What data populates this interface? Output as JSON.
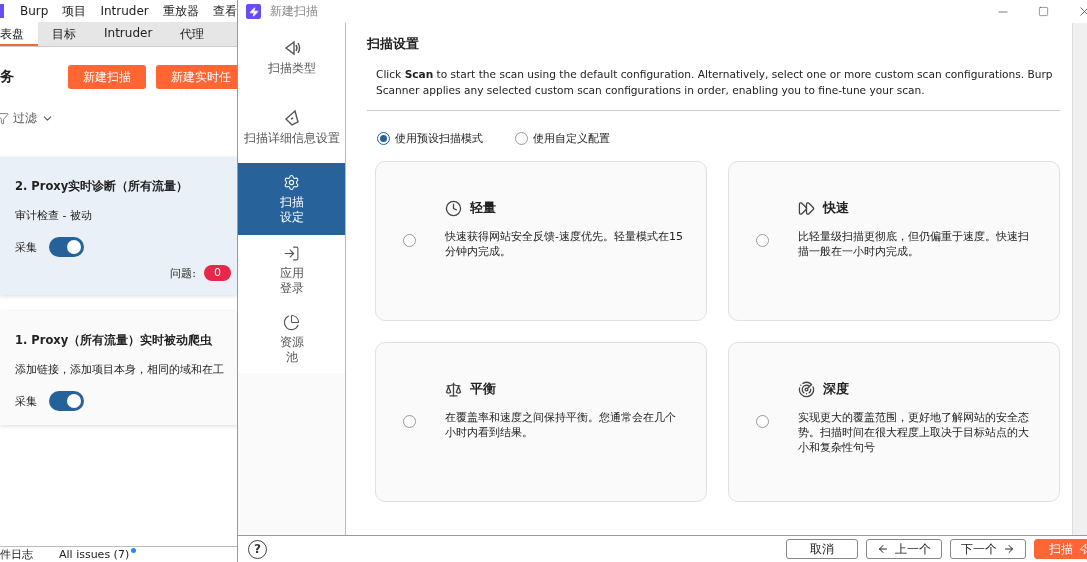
{
  "app": {
    "menu": [
      "Burp",
      "项目",
      "Intruder",
      "重放器",
      "查看"
    ],
    "tabs": [
      {
        "label": "表盘",
        "selected": true
      },
      {
        "label": "目标",
        "selected": false
      },
      {
        "label": "Intruder",
        "selected": false
      },
      {
        "label": "代理",
        "selected": false
      }
    ],
    "heading": "务",
    "buttons": [
      "新建扫描",
      "新建实时任"
    ],
    "filter": "过滤",
    "tasks": [
      {
        "title": "2. Proxy实时诊断（所有流量）",
        "subtitle": "审计检查 - 被动",
        "toggle_label": "采集",
        "on": true,
        "selected": true,
        "issues_label": "问题:",
        "issues": "0"
      },
      {
        "title": "1. Proxy（所有流量）实时被动爬虫",
        "subtitle": "添加链接，添加项目本身，相同的域和在工",
        "toggle_label": "采集",
        "on": true,
        "selected": false
      }
    ],
    "status_tabs": [
      {
        "label": "件日志",
        "dot": false
      },
      {
        "label": "All issues (7)",
        "dot": true
      }
    ]
  },
  "dialog": {
    "title": "新建扫描",
    "nav": [
      {
        "label": "扫描类型",
        "selected": false
      },
      {
        "label": "扫描详细信息设置",
        "selected": false
      },
      {
        "label": "扫描设定",
        "selected": true
      },
      {
        "label": "应用登录",
        "selected": false
      },
      {
        "label": "资源池",
        "selected": false
      }
    ],
    "heading": "扫描设置",
    "intro": "Click **Scan** to start the scan using the default configuration. Alternatively, select one or more custom scan configurations. Burp Scanner applies any selected custom scan configurations in order, enabling you to fine-tune your scan.",
    "modes": [
      {
        "label": "使用预设扫描模式",
        "selected": true
      },
      {
        "label": "使用自定义配置",
        "selected": false
      }
    ],
    "presets": [
      {
        "title": "轻量",
        "description": "快速获得网站安全反馈-速度优先。轻量模式在15分钟内完成。",
        "selected": false
      },
      {
        "title": "快速",
        "description": "比轻量级扫描更彻底，但仍偏重于速度。快速扫描一般在一小时内完成。",
        "selected": false
      },
      {
        "title": "平衡",
        "description": "在覆盖率和速度之间保持平衡。您通常会在几个小时内看到结果。",
        "selected": false
      },
      {
        "title": "深度",
        "description": "实现更大的覆盖范围，更好地了解网站的安全态势。扫描时间在很大程度上取决于目标站点的大小和复杂性句号",
        "selected": false
      }
    ],
    "help": "?",
    "footer_buttons": [
      {
        "kind": "plain",
        "label": "取消"
      },
      {
        "kind": "back",
        "label": "上一个"
      },
      {
        "kind": "next",
        "label": "下一个"
      },
      {
        "kind": "primary",
        "label": "扫描"
      }
    ]
  }
}
